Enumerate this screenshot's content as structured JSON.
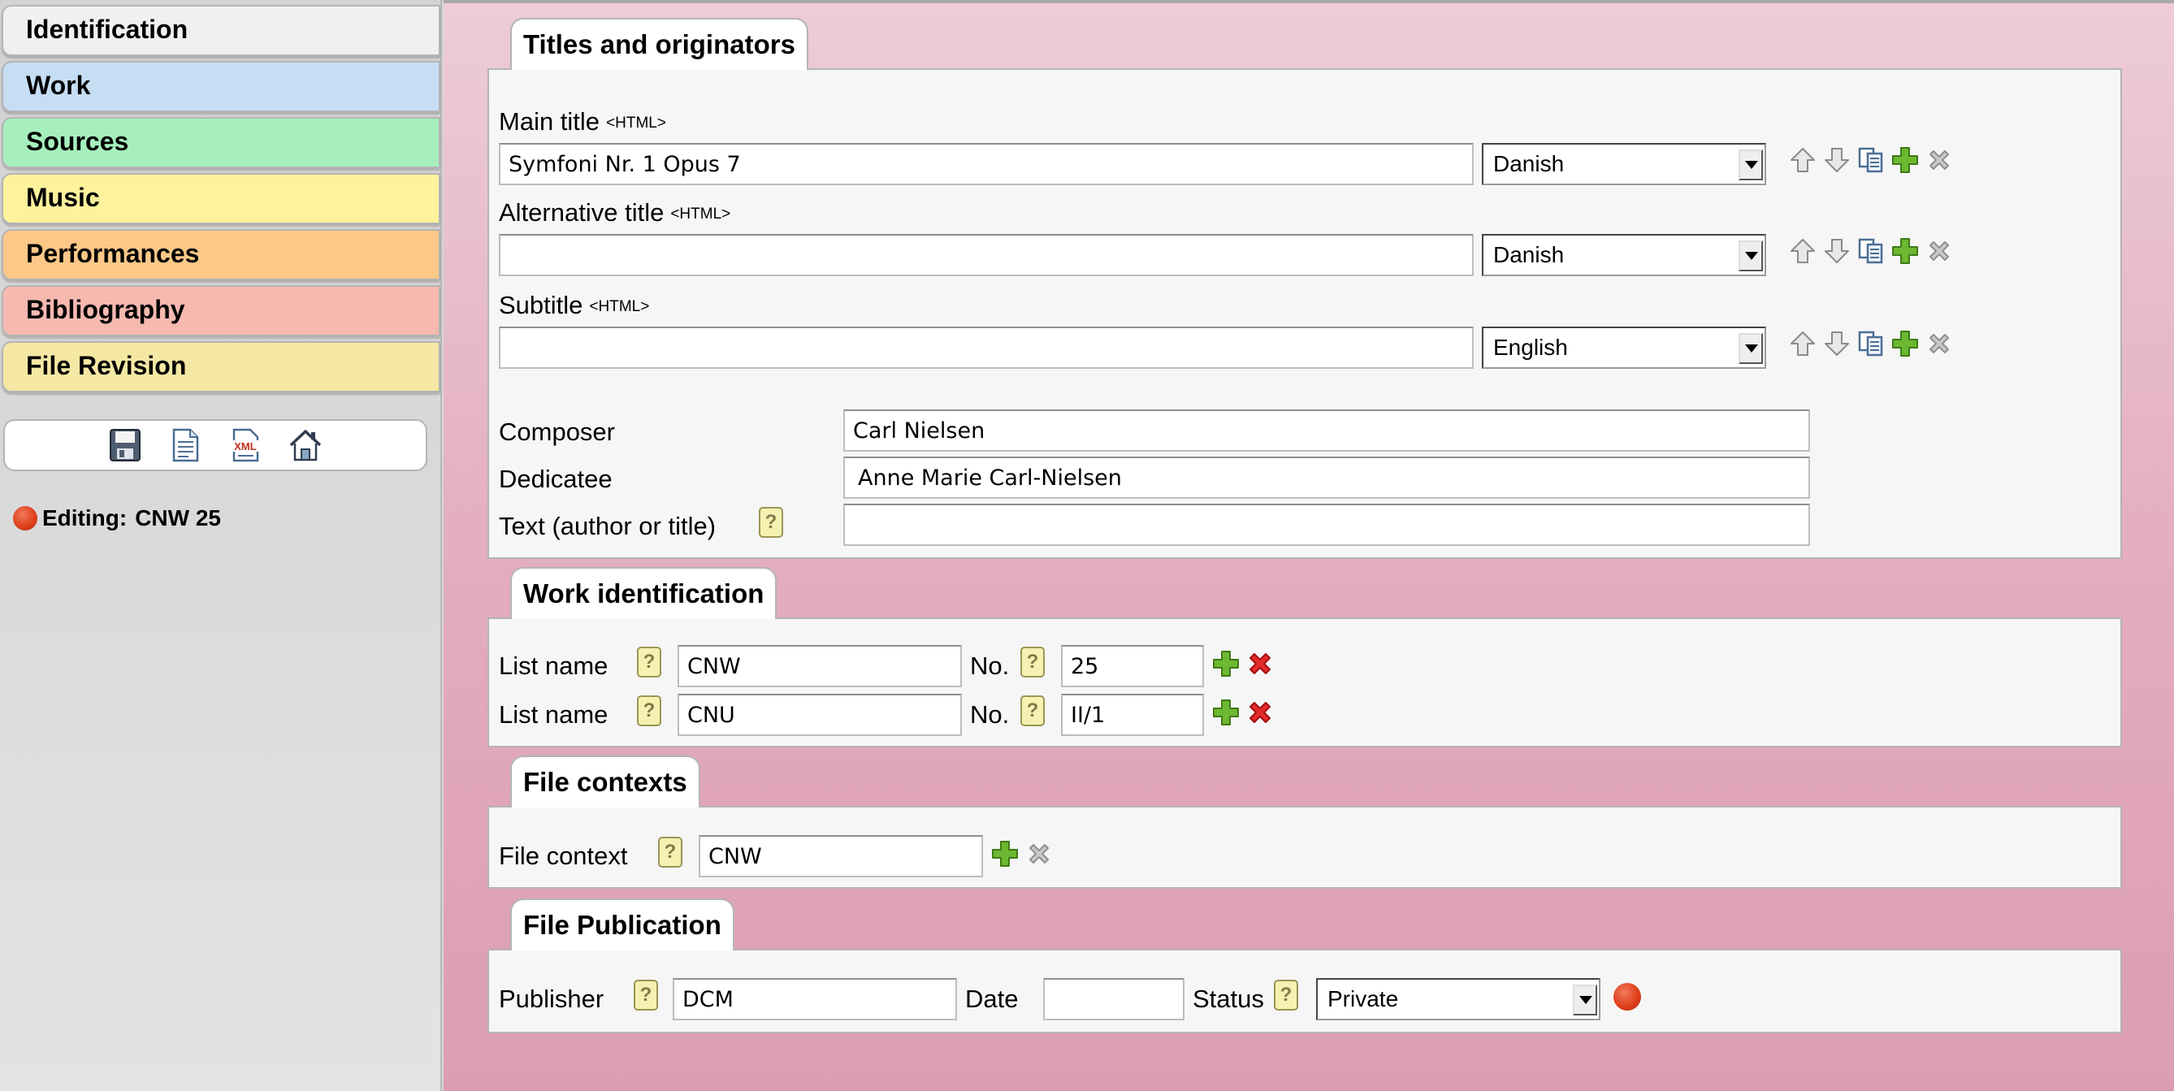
{
  "sidebar": {
    "tabs": [
      {
        "label": "Identification",
        "color": "#f0f0f0"
      },
      {
        "label": "Work",
        "color": "#c6def4"
      },
      {
        "label": "Sources",
        "color": "#a6efbd"
      },
      {
        "label": "Music",
        "color": "#fff29c"
      },
      {
        "label": "Performances",
        "color": "#fbc888"
      },
      {
        "label": "Bibliography",
        "color": "#f5b9b0"
      },
      {
        "label": "File Revision",
        "color": "#f5e8a4"
      }
    ],
    "toolbar": {
      "icons": [
        "save-icon",
        "document-icon",
        "xml-icon",
        "home-icon"
      ],
      "xml_label": "XML"
    },
    "editing": {
      "label": "Editing:",
      "value": "CNW 25"
    }
  },
  "titles": {
    "header": "Titles and originators",
    "html_tag": "<HTML>",
    "main_title": {
      "label": "Main title",
      "value": "Symfoni Nr. 1 Opus 7",
      "language": "Danish"
    },
    "alt_title": {
      "label": "Alternative title",
      "value": "",
      "language": "Danish"
    },
    "subtitle": {
      "label": "Subtitle",
      "value": "",
      "language": "English"
    },
    "composer": {
      "label": "Composer",
      "value": "Carl Nielsen"
    },
    "dedicatee": {
      "label": "Dedicatee",
      "value": "Anne Marie Carl-Nielsen"
    },
    "text_author": {
      "label": "Text (author or title)",
      "value": ""
    }
  },
  "work_identification": {
    "header": "Work identification",
    "list_label": "List name",
    "no_label": "No.",
    "rows": [
      {
        "list": "CNW",
        "no": "25"
      },
      {
        "list": "CNU",
        "no": "II/1"
      }
    ]
  },
  "file_contexts": {
    "header": "File contexts",
    "label": "File context",
    "value": "CNW"
  },
  "file_publication": {
    "header": "File Publication",
    "publisher_label": "Publisher",
    "publisher": "DCM",
    "date_label": "Date",
    "date": "",
    "status_label": "Status",
    "status": "Private"
  },
  "help_glyph": "?",
  "colors": {
    "accent_red": "#e0401c",
    "add_green": "#5fa52d",
    "delete_red": "#e02020"
  }
}
